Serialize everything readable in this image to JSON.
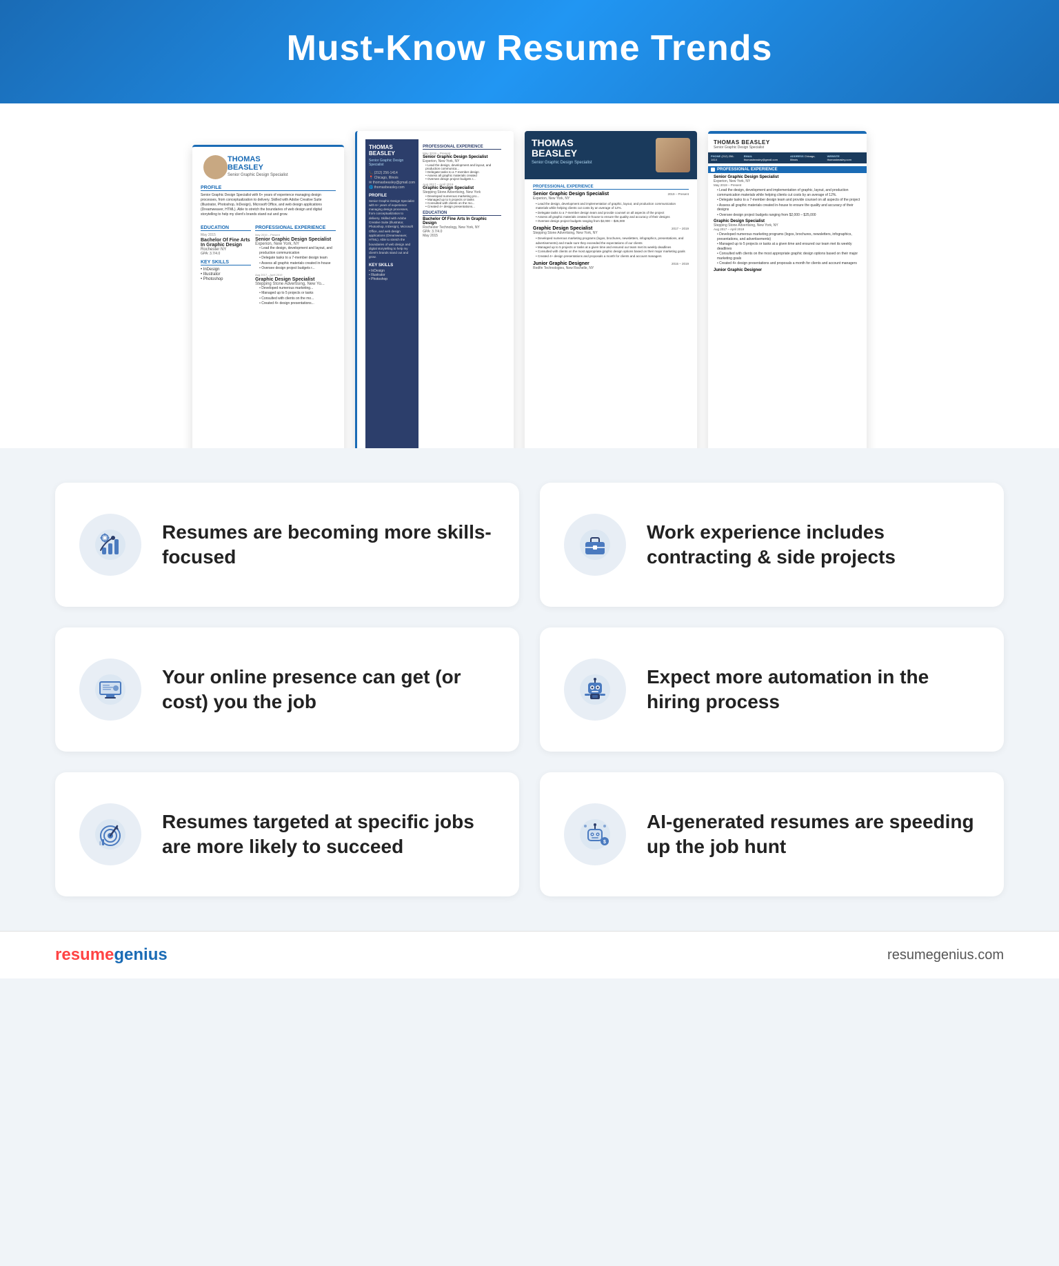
{
  "header": {
    "title": "Must-Know Resume Trends"
  },
  "resume": {
    "name_line1": "THOMAS",
    "name_line2": "BEASLEY",
    "title": "Senior Graphic Design Specialist",
    "contact": {
      "phone": "(212) 256-1414",
      "location": "Chicago, Illinois",
      "email": "thomasbeasley@gmail.com",
      "website": "thomasbeasley.com"
    },
    "profile": "Senior Graphic Design Specialist with 6+ years of experience managing design processes, from conceptualization to delivery. Skilled with Adobe Creative Suite (Illustrator, Photoshop, InDesign), Microsoft Office, and web design applications (Dreamweaver, HTML). Able to stretch the boundaries of web design and digital storytelling to help my client's brands stand out and grow.",
    "experience": [
      {
        "title": "Senior Graphic Design Specialist",
        "company": "Experion, New York, NY",
        "dates": "May 2019 – Present",
        "bullets": [
          "Lead the design, development and implementation of graphic, layout, and production communication materials while helping clients cut costs by an average of 12%",
          "Delegate tasks to a 7-member design team and provide counsel on all aspects of the project",
          "Assess all graphic materials created in-house to ensure the quality and accuracy of their designs",
          "Oversee design project budgets ranging from $2,000 – $25,000"
        ]
      },
      {
        "title": "Graphic Design Specialist",
        "company": "Stepping Stone Advertising, New York, NY",
        "dates": "Aug 2017 – April 2019",
        "bullets": [
          "Developed numerous marketing programs (logos, brochures, newsletters, infographics, presentations, and advertisements)",
          "Managed up to 5 projects or tasks at a given time and ensured our team met its weekly deadlines",
          "Consulted with clients on the most appropriate graphic design options based on their major marketing goals",
          "Created 4+ design presentations and proposals a month for clients and account managers"
        ]
      }
    ],
    "education": {
      "degree": "Bachelor Of Fine Arts In Graphic Design",
      "school": "Rochester Technology, New York, NY",
      "gpa": "GPA: 3.7/4.0",
      "date": "May 2015"
    },
    "skills": [
      "InDesign",
      "Illustrator",
      "Photoshop"
    ]
  },
  "trends": [
    {
      "id": "skills",
      "icon": "skills-icon",
      "text": "Resumes are becoming more skills-focused"
    },
    {
      "id": "contracting",
      "icon": "briefcase-icon",
      "text": "Work experience includes contracting & side projects"
    },
    {
      "id": "online",
      "icon": "monitor-icon",
      "text": "Your online presence can get (or cost) you the job"
    },
    {
      "id": "automation",
      "icon": "robot-icon",
      "text": "Expect more automation in the hiring process"
    },
    {
      "id": "targeted",
      "icon": "target-icon",
      "text": "Resumes targeted at specific jobs are more likely to succeed"
    },
    {
      "id": "ai",
      "icon": "ai-icon",
      "text": "AI-generated resumes are speeding up the job hunt"
    }
  ],
  "footer": {
    "brand_part1": "resume",
    "brand_part2": "genius",
    "url": "resumegenius.com"
  }
}
